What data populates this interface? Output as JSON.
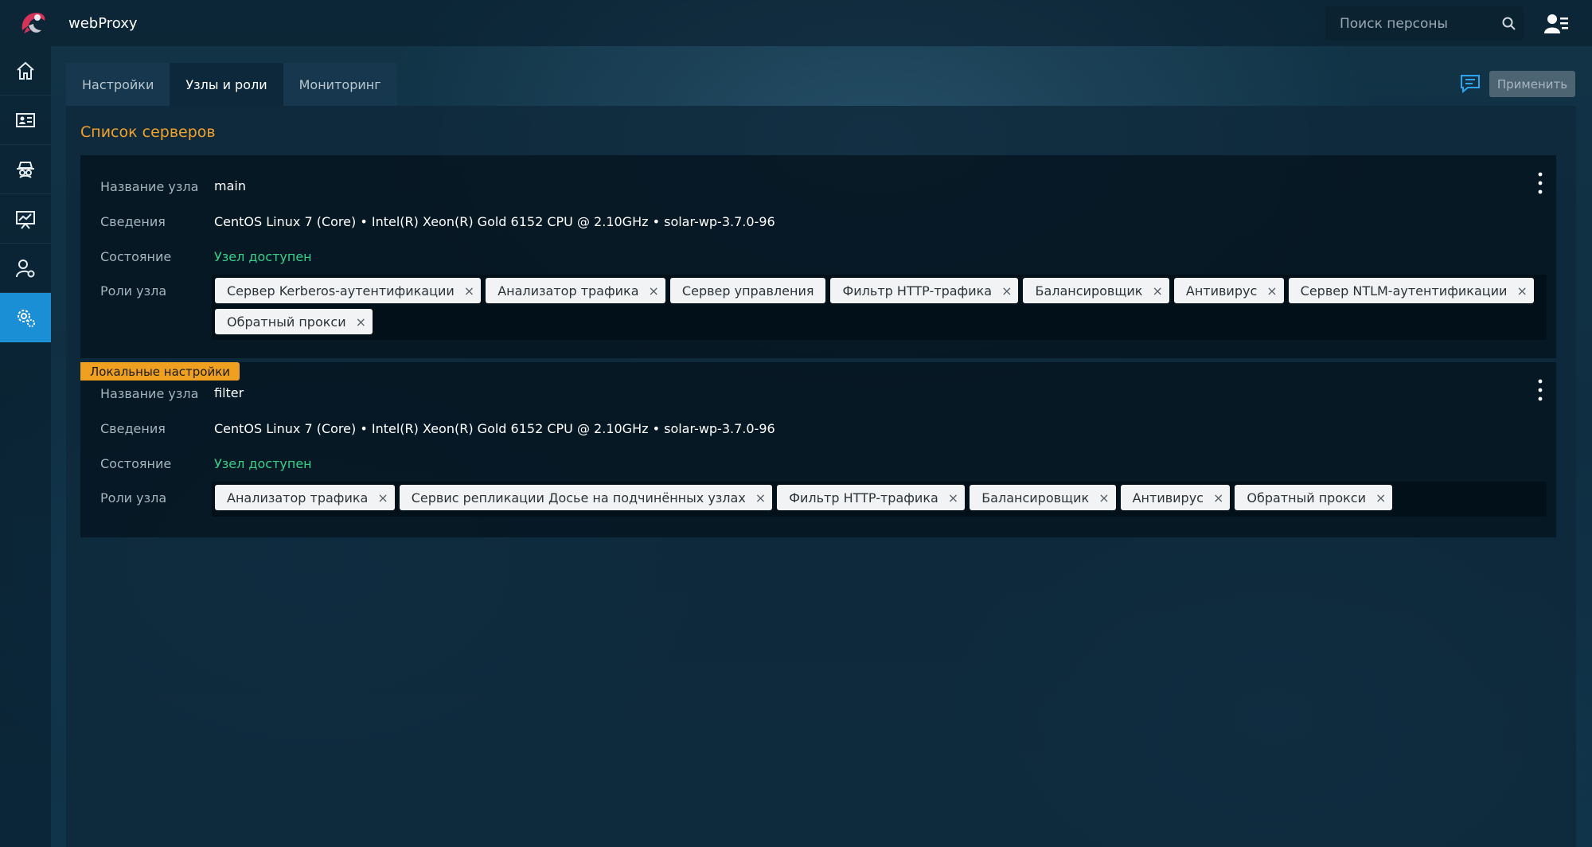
{
  "app": {
    "name": "webProxy"
  },
  "search": {
    "placeholder": "Поиск персоны"
  },
  "tabs": [
    {
      "label": "Настройки",
      "active": false
    },
    {
      "label": "Узлы и роли",
      "active": true
    },
    {
      "label": "Мониторинг",
      "active": false
    }
  ],
  "toolbar": {
    "apply_label": "Применить"
  },
  "section": {
    "title": "Список серверов"
  },
  "labels": {
    "node_name": "Название узла",
    "info": "Сведения",
    "state": "Состояние",
    "roles": "Роли узла"
  },
  "servers": [
    {
      "name": "main",
      "info": "CentOS Linux 7 (Core) • Intel(R) Xeon(R) Gold 6152 CPU @ 2.10GHz • solar-wp-3.7.0-96",
      "state": "Узел доступен",
      "badge": "",
      "roles": [
        "Сервер Kerberos-аутентификации",
        "Анализатор трафика",
        "Сервер управления",
        "Фильтр HTTP-трафика",
        "Балансировщик",
        "Антивирус",
        "Сервер NTLM-аутентификации",
        "Обратный прокси"
      ],
      "removable": [
        true,
        true,
        false,
        true,
        true,
        true,
        true,
        true
      ]
    },
    {
      "name": "filter",
      "info": "CentOS Linux 7 (Core) • Intel(R) Xeon(R) Gold 6152 CPU @ 2.10GHz • solar-wp-3.7.0-96",
      "state": "Узел доступен",
      "badge": "Локальные настройки",
      "roles": [
        "Анализатор трафика",
        "Сервис репликации Досье на подчинённых узлах",
        "Фильтр HTTP-трафика",
        "Балансировщик",
        "Антивирус",
        "Обратный прокси"
      ],
      "removable": [
        true,
        true,
        true,
        true,
        true,
        true
      ]
    }
  ],
  "chip_remove_glyph": "×",
  "colors": {
    "accent": "#1a8fd6",
    "section_title": "#f0a22a",
    "status_ok": "#37d08a",
    "badge": "#f0a020"
  },
  "sidebar": {
    "items": [
      {
        "icon": "home-icon"
      },
      {
        "icon": "id-card-icon"
      },
      {
        "icon": "spy-icon"
      },
      {
        "icon": "presentation-icon"
      },
      {
        "icon": "user-settings-icon"
      },
      {
        "icon": "settings-gear-icon",
        "active": true
      }
    ]
  }
}
